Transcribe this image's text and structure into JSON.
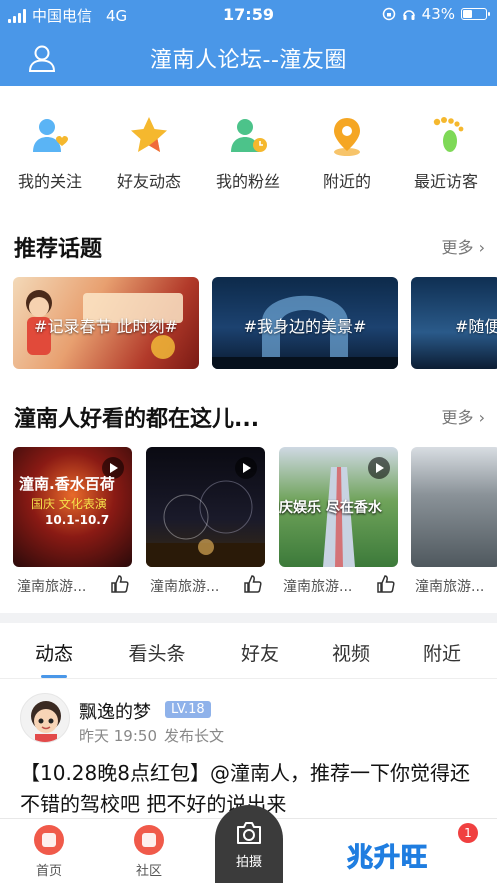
{
  "status_bar": {
    "carrier": "中国电信",
    "network": "4G",
    "time": "17:59",
    "battery_percent": "43%",
    "battery_level": 0.43
  },
  "header": {
    "title": "潼南人论坛--潼友圈",
    "user_icon": "user-icon"
  },
  "quick_menu": [
    {
      "label": "我的关注",
      "icon": "follow-user-heart-icon",
      "color": "#5ab4f5"
    },
    {
      "label": "好友动态",
      "icon": "star-icon",
      "color": "#f5b82e"
    },
    {
      "label": "我的粉丝",
      "icon": "fans-user-clock-icon",
      "color": "#4cc38a"
    },
    {
      "label": "附近的",
      "icon": "location-pin-icon",
      "color": "#f5a623"
    },
    {
      "label": "最近访客",
      "icon": "footprints-icon",
      "color": "#7ed957"
    }
  ],
  "topics": {
    "title": "推荐话题",
    "more": "更多",
    "items": [
      {
        "label": "#记录春节 此时刻#"
      },
      {
        "label": "#我身边的美景#"
      },
      {
        "label": "#随便"
      }
    ]
  },
  "videos": {
    "title": "潼南人好看的都在这儿...",
    "more": "更多",
    "items": [
      {
        "author": "潼南旅游...",
        "overlay_title": "潼南.香水百荷",
        "overlay_sub": "国庆 文化表演",
        "overlay_date": "10.1-10.7"
      },
      {
        "author": "潼南旅游..."
      },
      {
        "author": "潼南旅游...",
        "overlay_title": "庆娱乐 尽在香水"
      },
      {
        "author": "潼南旅游..."
      }
    ]
  },
  "tabs": {
    "items": [
      "动态",
      "看头条",
      "好友",
      "视频",
      "附近"
    ],
    "active_index": 0
  },
  "post": {
    "username": "飘逸的梦",
    "level": "LV.18",
    "time": "昨天 19:50",
    "action": "发布长文",
    "text": "【10.28晚8点红包】@潼南人，推荐一下你觉得还不错的驾校吧 把不好的说出来"
  },
  "bottom_bar": {
    "home": "首页",
    "community": "社区",
    "camera": "拍摄",
    "brand": "兆升旺",
    "badge_count": "1"
  }
}
